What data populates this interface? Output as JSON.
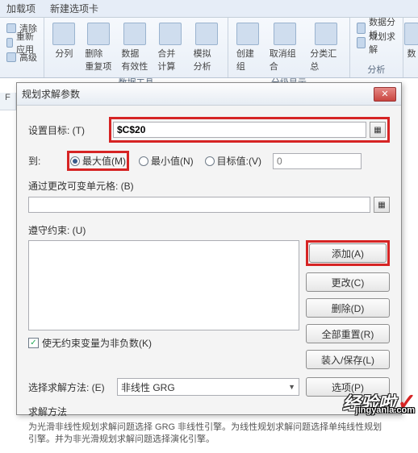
{
  "tabs": {
    "addin": "加载项",
    "newtab": "新建选项卡"
  },
  "ribbon": {
    "group1": {
      "clear": "清除",
      "reapply": "重新应用",
      "advanced": "高级"
    },
    "group2": {
      "text_to_cols": "分列",
      "remove_dup": "删除\n重复项",
      "data_valid": "数据\n有效性",
      "consolidate": "合并计算",
      "whatif": "模拟分析",
      "label": "数据工具"
    },
    "group3": {
      "group": "创建组",
      "ungroup": "取消组合",
      "subtotal": "分类汇总",
      "label": "分级显示"
    },
    "group4": {
      "data_analysis": "数据分析",
      "solver": "规划求解",
      "label": "分析"
    },
    "group5_partial": "数"
  },
  "row_header": "F",
  "dialog": {
    "title": "规划求解参数",
    "set_target": "设置目标: (T)",
    "target_value": "$C$20",
    "to_label": "到:",
    "opt_max": "最大值(M)",
    "opt_min": "最小值(N)",
    "opt_target": "目标值:(V)",
    "target_num": "0",
    "change_cells": "通过更改可变单元格: (B)",
    "constraints": "遵守约束: (U)",
    "btn_add": "添加(A)",
    "btn_change": "更改(C)",
    "btn_delete": "删除(D)",
    "btn_reset": "全部重置(R)",
    "btn_loadsave": "装入/保存(L)",
    "chk_nonneg": "使无约束变量为非负数(K)",
    "method_label": "选择求解方法: (E)",
    "method_value": "非线性 GRG",
    "btn_options": "选项(P)",
    "solve_method": "求解方法",
    "info": "为光滑非线性规划求解问题选择 GRG 非线性引擎。为线性规划求解问题选择单纯线性规划引擎。并为非光滑规划求解问题选择演化引擎。"
  },
  "watermark": {
    "brand": "经验啦",
    "url": "jingyanla.com"
  }
}
